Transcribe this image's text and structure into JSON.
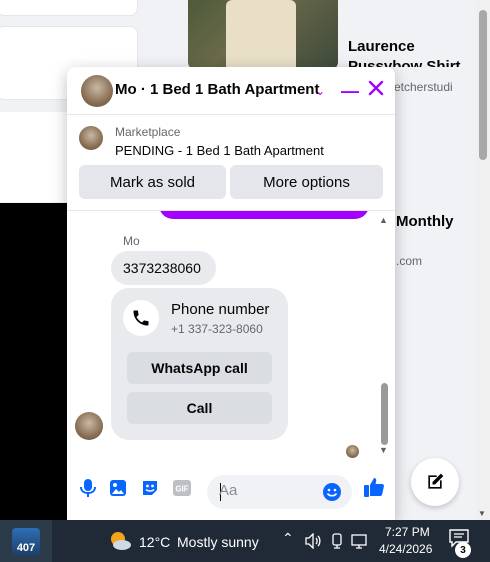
{
  "background": {
    "listing_title_line1": "Laurence",
    "listing_title_line2": "Pussybow Shirt",
    "listing_seller_partial": "etcherstudi",
    "listing2_partial": "Monthly",
    "listing2_sub_partial": ".com"
  },
  "chat": {
    "title": "Mo · 1 Bed 1 Bath Apartment",
    "marketplace_label": "Marketplace",
    "listing_status": "PENDING - 1 Bed 1 Bath Apartment",
    "mark_sold_label": "Mark as sold",
    "more_options_label": "More options",
    "sender_name": "Mo",
    "message_text": "3373238060",
    "phone_card": {
      "title": "Phone number",
      "number": "+1 337-323-8060",
      "whatsapp_label": "WhatsApp call",
      "call_label": "Call"
    },
    "composer_placeholder": "Aa",
    "accent_color": "#a200ff",
    "like_color": "#0866ff"
  },
  "taskbar": {
    "start_badge": "407",
    "temperature": "12°C",
    "weather": "Mostly sunny",
    "time": "7:27 PM",
    "date": "4/24/2026",
    "notification_count": "3"
  }
}
